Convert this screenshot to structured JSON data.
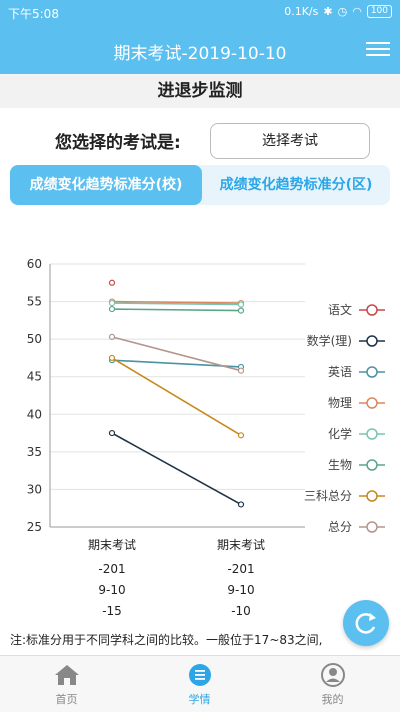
{
  "status_bar": {
    "time": "下午5:08",
    "net_speed": "0.1K/s",
    "battery": "100"
  },
  "header": {
    "title": "期末考试-2019-10-10"
  },
  "page_title": "进退步监测",
  "exam_select": {
    "label": "您选择的考试是:",
    "button_label": "选择考试"
  },
  "tabs": [
    {
      "label": "成绩变化趋势标准分(校)"
    },
    {
      "label": "成绩变化趋势标准分(区)"
    }
  ],
  "chart_data": {
    "type": "line",
    "categories": [
      "期末考试",
      "期末考试"
    ],
    "category_sublabels": [
      [
        "-201",
        "9-10",
        "-15"
      ],
      [
        "-201",
        "9-10",
        "-10"
      ]
    ],
    "ylim": [
      25,
      60
    ],
    "yticks": [
      25,
      30,
      35,
      40,
      45,
      50,
      55,
      60
    ],
    "grid": true,
    "legend_position": "right",
    "series": [
      {
        "name": "语文",
        "color": "#c94848",
        "values": [
          57.5,
          null
        ]
      },
      {
        "name": "数学(理)",
        "color": "#1d3346",
        "values": [
          37.5,
          28
        ]
      },
      {
        "name": "英语",
        "color": "#4a93a3",
        "values": [
          47.2,
          46.3
        ]
      },
      {
        "name": "物理",
        "color": "#d9875e",
        "values": [
          55,
          54.8
        ]
      },
      {
        "name": "化学",
        "color": "#7cc3b2",
        "values": [
          54.8,
          54.6
        ]
      },
      {
        "name": "生物",
        "color": "#5aa589",
        "values": [
          54,
          53.8
        ]
      },
      {
        "name": "三科总分",
        "color": "#c58a1e",
        "values": [
          47.5,
          37.2
        ]
      },
      {
        "name": "总分",
        "color": "#b4958e",
        "values": [
          50.3,
          45.8
        ]
      }
    ]
  },
  "note": "注:标准分用于不同学科之间的比较。一般位于17~83之间,",
  "bottom_nav": [
    {
      "label": "首页",
      "icon": "home-icon"
    },
    {
      "label": "学情",
      "icon": "list-icon"
    },
    {
      "label": "我的",
      "icon": "user-icon"
    }
  ]
}
